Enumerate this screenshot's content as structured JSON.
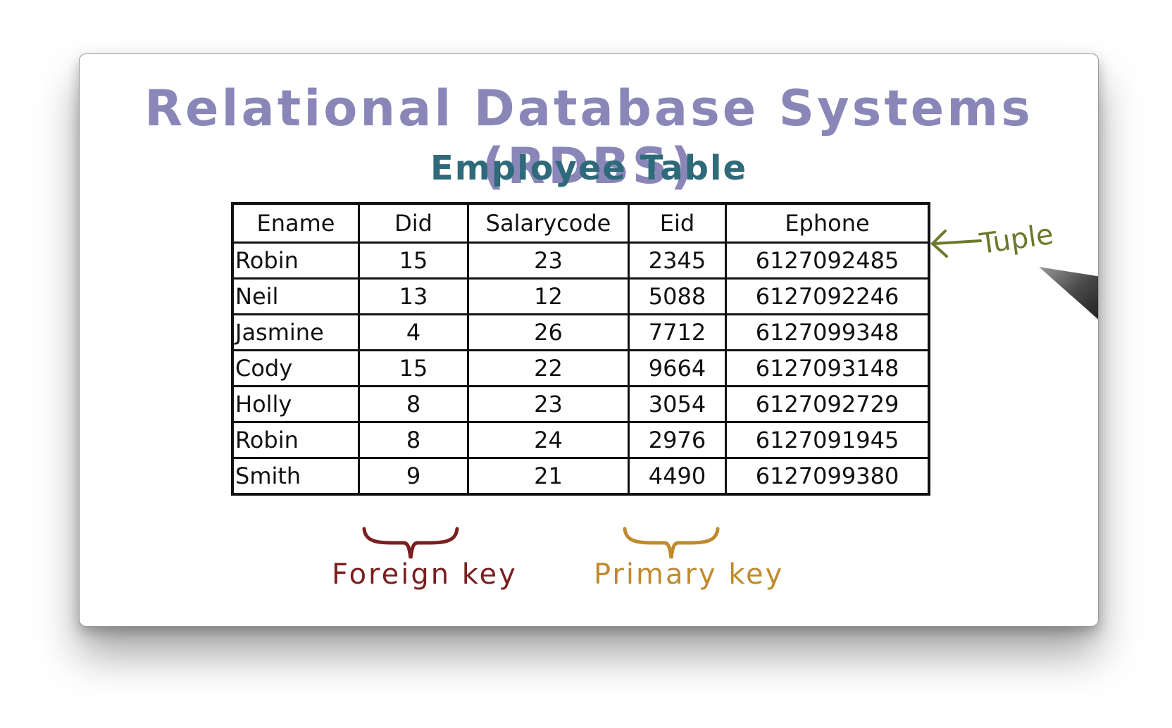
{
  "title": "Relational Database Systems (RDBS)",
  "subtitle": "Employee Table",
  "table": {
    "headers": [
      "Ename",
      "Did",
      "Salarycode",
      "Eid",
      "Ephone"
    ],
    "rows": [
      [
        "Robin",
        "15",
        "23",
        "2345",
        "6127092485"
      ],
      [
        "Neil",
        "13",
        "12",
        "5088",
        "6127092246"
      ],
      [
        "Jasmine",
        "4",
        "26",
        "7712",
        "6127099348"
      ],
      [
        "Cody",
        "15",
        "22",
        "9664",
        "6127093148"
      ],
      [
        "Holly",
        "8",
        "23",
        "3054",
        "6127092729"
      ],
      [
        "Robin",
        "8",
        "24",
        "2976",
        "6127091945"
      ],
      [
        "Smith",
        "9",
        "21",
        "4490",
        "6127099380"
      ]
    ]
  },
  "annotations": {
    "foreign_key": "Foreign key",
    "primary_key": "Primary key",
    "tuple": "Tuple"
  },
  "colors": {
    "title": "#8a86b8",
    "subtitle": "#2f6a7a",
    "foreign_key": "#7a1f1f",
    "primary_key": "#c08a2e",
    "tuple": "#6b7a2a"
  },
  "icons": {
    "foreign_brace": "curly-brace-icon",
    "primary_brace": "curly-brace-icon",
    "tuple_arrow": "arrow-left-icon",
    "pen": "pen-icon"
  }
}
